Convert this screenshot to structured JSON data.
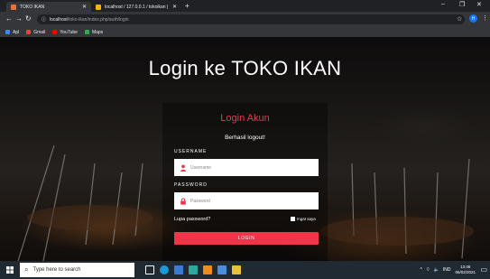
{
  "browser": {
    "tabs": [
      {
        "title": "TOKO IKAN",
        "favicon_color": "#e8733a"
      },
      {
        "title": "localhost / 127.0.0.1 / tokoikan | ...",
        "favicon_color": "#f4b400"
      }
    ],
    "new_tab": "+",
    "address": {
      "host": "localhost",
      "path": "/toko-ikan/index.php/auth/login"
    },
    "profile_initial": "H",
    "bookmarks": [
      {
        "label": "Apl",
        "color": "#4285f4"
      },
      {
        "label": "Gmail",
        "color": "#ea4335"
      },
      {
        "label": "YouTube",
        "color": "#ff0000"
      },
      {
        "label": "Maps",
        "color": "#34a853"
      }
    ]
  },
  "page": {
    "heading": "Login ke TOKO IKAN",
    "card_title": "Login Akun",
    "message": "Berhasil logout!",
    "username_label": "USERNAME",
    "username_placeholder": "Username",
    "password_label": "PASSWORD",
    "password_placeholder": "Password",
    "forgot": "Lupa password?",
    "remember": "Ingat saya",
    "login_button": "LOGIN",
    "accent_color": "#f0354b"
  },
  "taskbar": {
    "search_placeholder": "Type here to search",
    "tray_lang": "IND",
    "time": "13.08",
    "date": "06/02/2021"
  }
}
